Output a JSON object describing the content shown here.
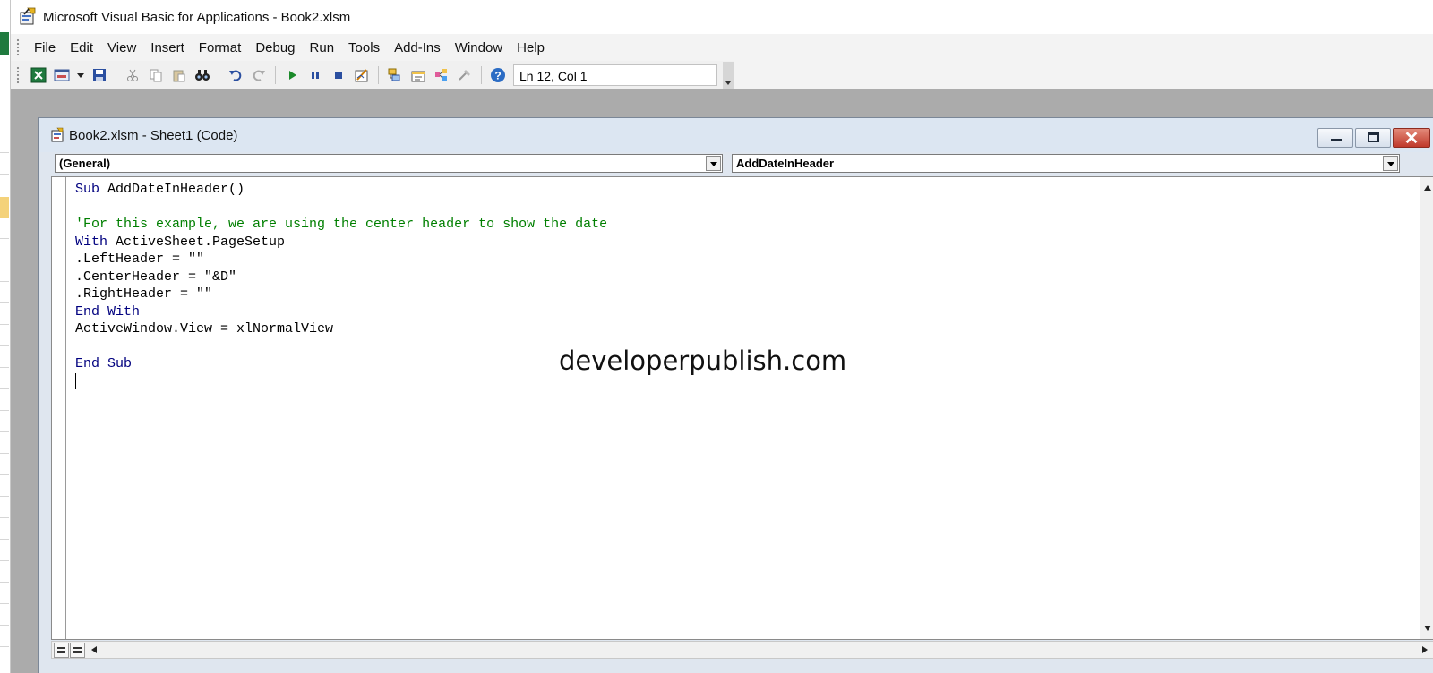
{
  "window": {
    "title": "Microsoft Visual Basic for Applications - Book2.xlsm"
  },
  "menu": {
    "items": [
      {
        "label": "File",
        "name": "file"
      },
      {
        "label": "Edit",
        "name": "edit"
      },
      {
        "label": "View",
        "name": "view"
      },
      {
        "label": "Insert",
        "name": "insert"
      },
      {
        "label": "Format",
        "name": "format"
      },
      {
        "label": "Debug",
        "name": "debug"
      },
      {
        "label": "Run",
        "name": "run"
      },
      {
        "label": "Tools",
        "name": "tools"
      },
      {
        "label": "Add-Ins",
        "name": "add-ins"
      },
      {
        "label": "Window",
        "name": "window"
      },
      {
        "label": "Help",
        "name": "help"
      }
    ]
  },
  "toolbar": {
    "status": "Ln 12, Col 1",
    "icons": [
      "excel-icon",
      "insert-userform-icon",
      "save-icon",
      "cut-icon",
      "copy-icon",
      "paste-icon",
      "find-icon",
      "undo-icon",
      "redo-icon",
      "run-icon",
      "break-icon",
      "reset-icon",
      "design-mode-icon",
      "project-explorer-icon",
      "properties-icon",
      "object-browser-icon",
      "toolbox-icon",
      "help-icon"
    ]
  },
  "code_window": {
    "title": "Book2.xlsm - Sheet1 (Code)",
    "object_combo": "(General)",
    "procedure_combo": "AddDateInHeader",
    "lines": [
      {
        "kw": "Sub",
        "text": " AddDateInHeader()"
      },
      {
        "text": ""
      },
      {
        "comment": "'For this example, we are using the center header to show the date"
      },
      {
        "kw": "With",
        "text": " ActiveSheet.PageSetup"
      },
      {
        "text": ".LeftHeader = \"\""
      },
      {
        "text": ".CenterHeader = \"&D\""
      },
      {
        "text": ".RightHeader = \"\""
      },
      {
        "kw": "End With",
        "text": ""
      },
      {
        "text": "ActiveWindow.View = xlNormalView"
      },
      {
        "text": ""
      },
      {
        "kw": "End Sub",
        "text": ""
      },
      {
        "text": "",
        "caret": true
      }
    ]
  },
  "watermark": "developerpublish.com",
  "colors": {
    "keyword": "#00007f",
    "comment": "#007f00",
    "close_button": "#c0392b"
  }
}
